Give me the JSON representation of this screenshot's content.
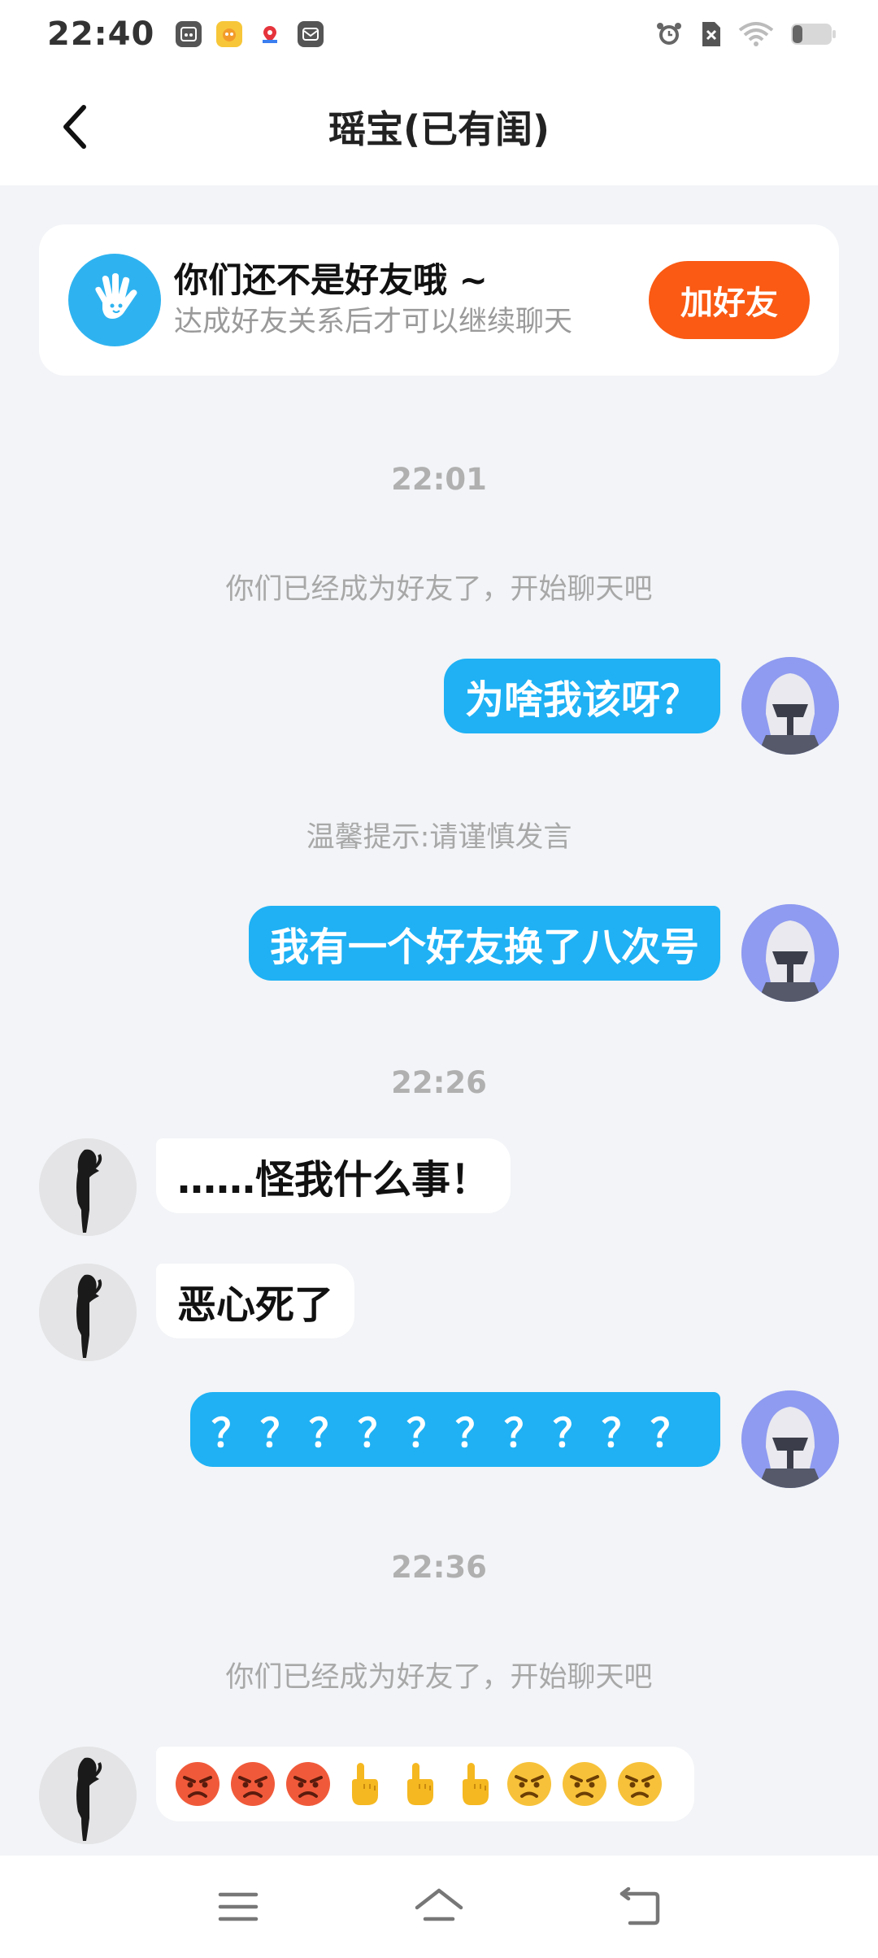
{
  "status_bar": {
    "time": "22:40"
  },
  "header": {
    "title": "瑶宝(已有闺)"
  },
  "banner": {
    "title": "你们还不是好友哦 ~",
    "subtitle": "达成好友关系后才可以继续聊天",
    "button_label": "加好友"
  },
  "chat": {
    "timestamps": [
      "22:01",
      "22:26",
      "22:36"
    ],
    "system_messages": {
      "friends_1": "你们已经成为好友了，开始聊天吧",
      "warning": "温馨提示:请谨慎发言",
      "friends_2": "你们已经成为好友了，开始聊天吧"
    },
    "messages": [
      {
        "from": "me",
        "text": "为啥我该呀？"
      },
      {
        "from": "me",
        "text": "我有一个好友换了八次号"
      },
      {
        "from": "her",
        "text": "……怪我什么事！"
      },
      {
        "from": "her",
        "text": "恶心死了"
      },
      {
        "from": "me",
        "text": "？？？？？？？？？？"
      },
      {
        "from": "her",
        "emojis": [
          "angry-face",
          "angry-face",
          "angry-face",
          "pointing-up-hand",
          "pointing-up-hand",
          "pointing-up-hand",
          "frowning-face",
          "frowning-face",
          "frowning-face"
        ]
      }
    ]
  },
  "colors": {
    "accent_blue": "#1fb1f4",
    "add_orange": "#fa5a14",
    "background": "#f2f4f7"
  }
}
